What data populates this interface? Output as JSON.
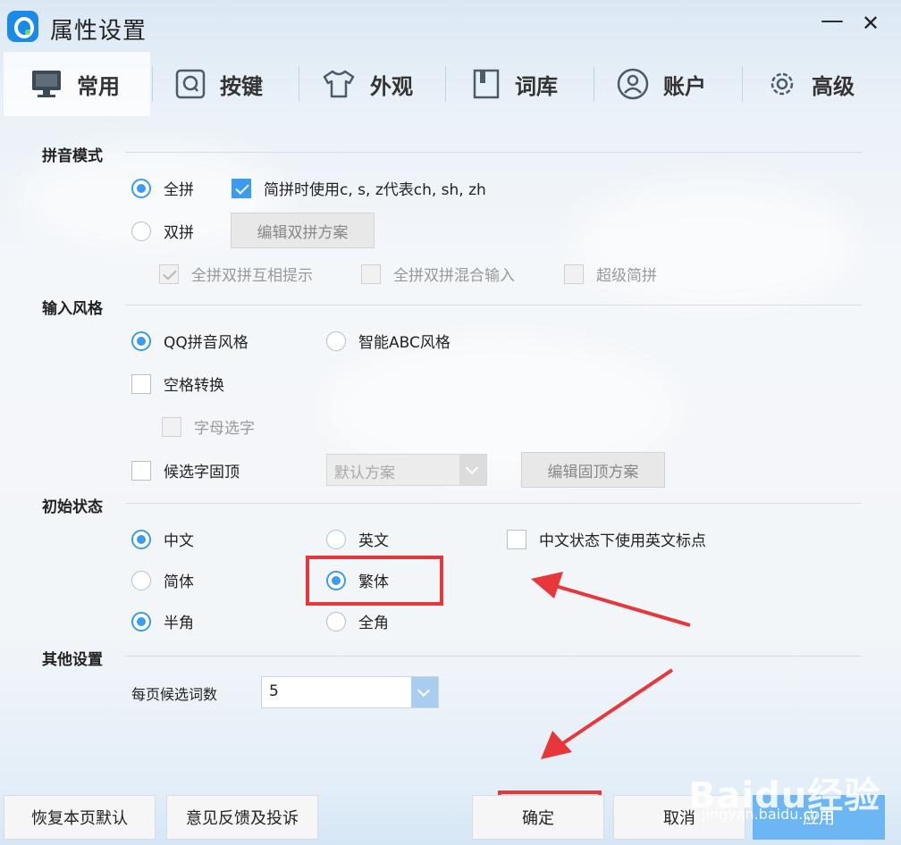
{
  "window": {
    "title": "属性设置",
    "minimize": "—",
    "close": "✕"
  },
  "tabs": [
    {
      "label": "常用",
      "icon": "monitor-icon"
    },
    {
      "label": "按键",
      "icon": "key-icon"
    },
    {
      "label": "外观",
      "icon": "tshirt-icon"
    },
    {
      "label": "词库",
      "icon": "book-icon"
    },
    {
      "label": "账户",
      "icon": "user-icon"
    },
    {
      "label": "高级",
      "icon": "gear-icon"
    }
  ],
  "sections": {
    "pinyin": {
      "title": "拼音模式",
      "full": "全拼",
      "simplified_cszh": "简拼时使用c, s, z代表ch, sh, zh",
      "double": "双拼",
      "edit_double": "编辑双拼方案",
      "mutual_hint": "全拼双拼互相提示",
      "mixed_input": "全拼双拼混合输入",
      "super_simple": "超级简拼"
    },
    "style": {
      "title": "输入风格",
      "qq_style": "QQ拼音风格",
      "abc_style": "智能ABC风格",
      "space_convert": "空格转换",
      "letter_select": "字母选字",
      "pin_candidate": "候选字固顶",
      "pin_scheme": "默认方案",
      "edit_pin": "编辑固顶方案"
    },
    "initial": {
      "title": "初始状态",
      "chinese": "中文",
      "english": "英文",
      "en_punct": "中文状态下使用英文标点",
      "simplified": "简体",
      "traditional": "繁体",
      "half_width": "半角",
      "full_width": "全角"
    },
    "other": {
      "title": "其他设置",
      "per_page": "每页候选词数",
      "per_page_value": "5"
    }
  },
  "buttons": {
    "restore": "恢复本页默认",
    "feedback": "意见反馈及投诉",
    "ok": "确定",
    "cancel": "取消",
    "apply": "应用"
  },
  "watermark": {
    "brand": "Baidu经验",
    "url": "jingyan.baidu.com"
  },
  "colors": {
    "accent": "#3a9bef",
    "annotation": "#e8373a"
  }
}
